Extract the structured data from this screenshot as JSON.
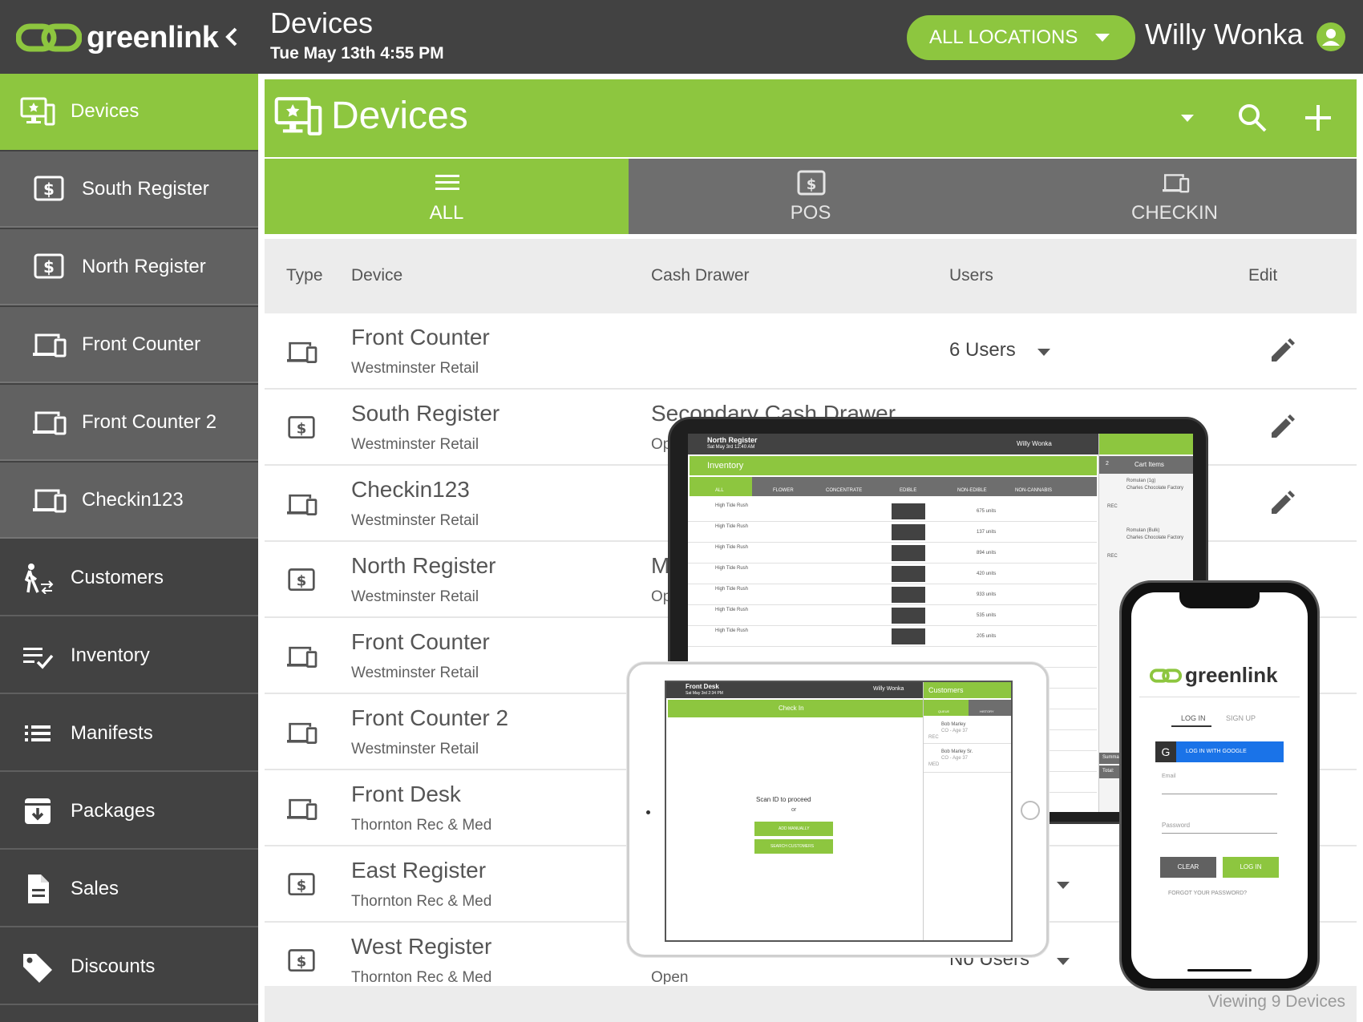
{
  "header": {
    "brand": "greenlink",
    "collapse_icon": "chevron-left-icon",
    "title": "Devices",
    "datetime": "Tue May 13th 4:55 PM",
    "location_button": "ALL LOCATIONS",
    "user": "Willy Wonka"
  },
  "colors": {
    "accent": "#8dc63f",
    "dark": "#424242",
    "sidebar_sub": "#616161",
    "tab_inactive": "#6e6e6e"
  },
  "sidebar": {
    "items": [
      {
        "label": "Devices",
        "icon": "devices-icon"
      },
      {
        "label": "South Register",
        "icon": "register-icon"
      },
      {
        "label": "North Register",
        "icon": "register-icon"
      },
      {
        "label": "Front Counter",
        "icon": "checkin-icon"
      },
      {
        "label": "Front Counter 2",
        "icon": "checkin-icon"
      },
      {
        "label": "Checkin123",
        "icon": "checkin-icon"
      },
      {
        "label": "Customers",
        "icon": "customers-icon"
      },
      {
        "label": "Inventory",
        "icon": "inventory-icon"
      },
      {
        "label": "Manifests",
        "icon": "manifests-icon"
      },
      {
        "label": "Packages",
        "icon": "packages-icon"
      },
      {
        "label": "Sales",
        "icon": "sales-icon"
      },
      {
        "label": "Discounts",
        "icon": "discounts-icon"
      }
    ]
  },
  "panel": {
    "title": "Devices",
    "tabs": [
      {
        "label": "ALL",
        "icon": "list-icon"
      },
      {
        "label": "POS",
        "icon": "register-icon"
      },
      {
        "label": "CHECKIN",
        "icon": "checkin-icon"
      }
    ],
    "columns": [
      "Type",
      "Device",
      "Cash Drawer",
      "Users",
      "Edit"
    ],
    "rows": [
      {
        "type": "checkin",
        "name": "Front Counter",
        "location": "Westminster Retail",
        "drawer": "",
        "drawer_status": "",
        "users": "6 Users"
      },
      {
        "type": "pos",
        "name": "South Register",
        "location": "Westminster Retail",
        "drawer": "Secondary Cash Drawer",
        "drawer_status": "Op",
        "users": ""
      },
      {
        "type": "checkin",
        "name": "Checkin123",
        "location": "Westminster Retail",
        "drawer": "",
        "drawer_status": "",
        "users": ""
      },
      {
        "type": "pos",
        "name": "North Register",
        "location": "Westminster Retail",
        "drawer": "M",
        "drawer_status": "Op",
        "users": ""
      },
      {
        "type": "checkin",
        "name": "Front Counter",
        "location": "Westminster Retail",
        "drawer": "",
        "drawer_status": "",
        "users": ""
      },
      {
        "type": "checkin",
        "name": "Front Counter 2",
        "location": "Westminster Retail",
        "drawer": "",
        "drawer_status": "",
        "users": ""
      },
      {
        "type": "checkin",
        "name": "Front Desk",
        "location": "Thornton Rec & Med",
        "drawer": "",
        "drawer_status": "",
        "users": ""
      },
      {
        "type": "pos",
        "name": "East Register",
        "location": "Thornton Rec & Med",
        "drawer": "",
        "drawer_status": "",
        "users": ""
      },
      {
        "type": "pos",
        "name": "West Register",
        "location": "Thornton Rec & Med",
        "drawer": "",
        "drawer_status": "Open",
        "users": "No Users"
      }
    ],
    "footer": "Viewing 9 Devices"
  },
  "mockups": {
    "tablet_pos": {
      "device": "North Register",
      "date": "Sat May 3rd 12:40 AM",
      "user": "Willy Wonka",
      "section": "Inventory",
      "categories": [
        "ALL",
        "FLOWER",
        "CONCENTRATE",
        "EDIBLE",
        "NON-EDIBLE",
        "NON-CANNABIS"
      ],
      "cart_title": "Cart Items",
      "cart_count": "2",
      "product": "High Tide Rush",
      "units": [
        "675 units",
        "137 units",
        "894 units",
        "420 units",
        "933 units",
        "535 units",
        "205 units"
      ],
      "cart_items": [
        {
          "name": "Romulan (1g)",
          "vendor": "Charles Chocolate Factory",
          "tag": "REC"
        },
        {
          "name": "Romulan (Bulk)",
          "vendor": "Charles Chocolate Factory",
          "tag": "REC"
        }
      ],
      "summary": "Summary",
      "total": "Total:"
    },
    "tablet_checkin": {
      "device": "Front Desk",
      "date": "Sat May 3rd 2:34 PM",
      "user": "Willy Wonka",
      "section": "Check In",
      "customers_title": "Customers",
      "tabs": [
        "QUEUE",
        "HISTORY"
      ],
      "prompt": "Scan ID to proceed",
      "or": "or",
      "add_manually": "ADD MANUALLY",
      "search": "SEARCH CUSTOMERS",
      "queue": [
        {
          "name": "Bob Marley",
          "detail": "CO - Age 37",
          "tag": "REC"
        },
        {
          "name": "Bob Marley Sr.",
          "detail": "CO - Age 37",
          "tag": "MED"
        }
      ]
    },
    "phone": {
      "brand": "greenlink",
      "tabs": [
        "LOG IN",
        "SIGN UP"
      ],
      "google": "LOG IN WITH GOOGLE",
      "email_label": "Email",
      "password_label": "Password",
      "clear": "CLEAR",
      "login": "LOG IN",
      "forgot": "FORGOT YOUR PASSWORD?"
    }
  }
}
